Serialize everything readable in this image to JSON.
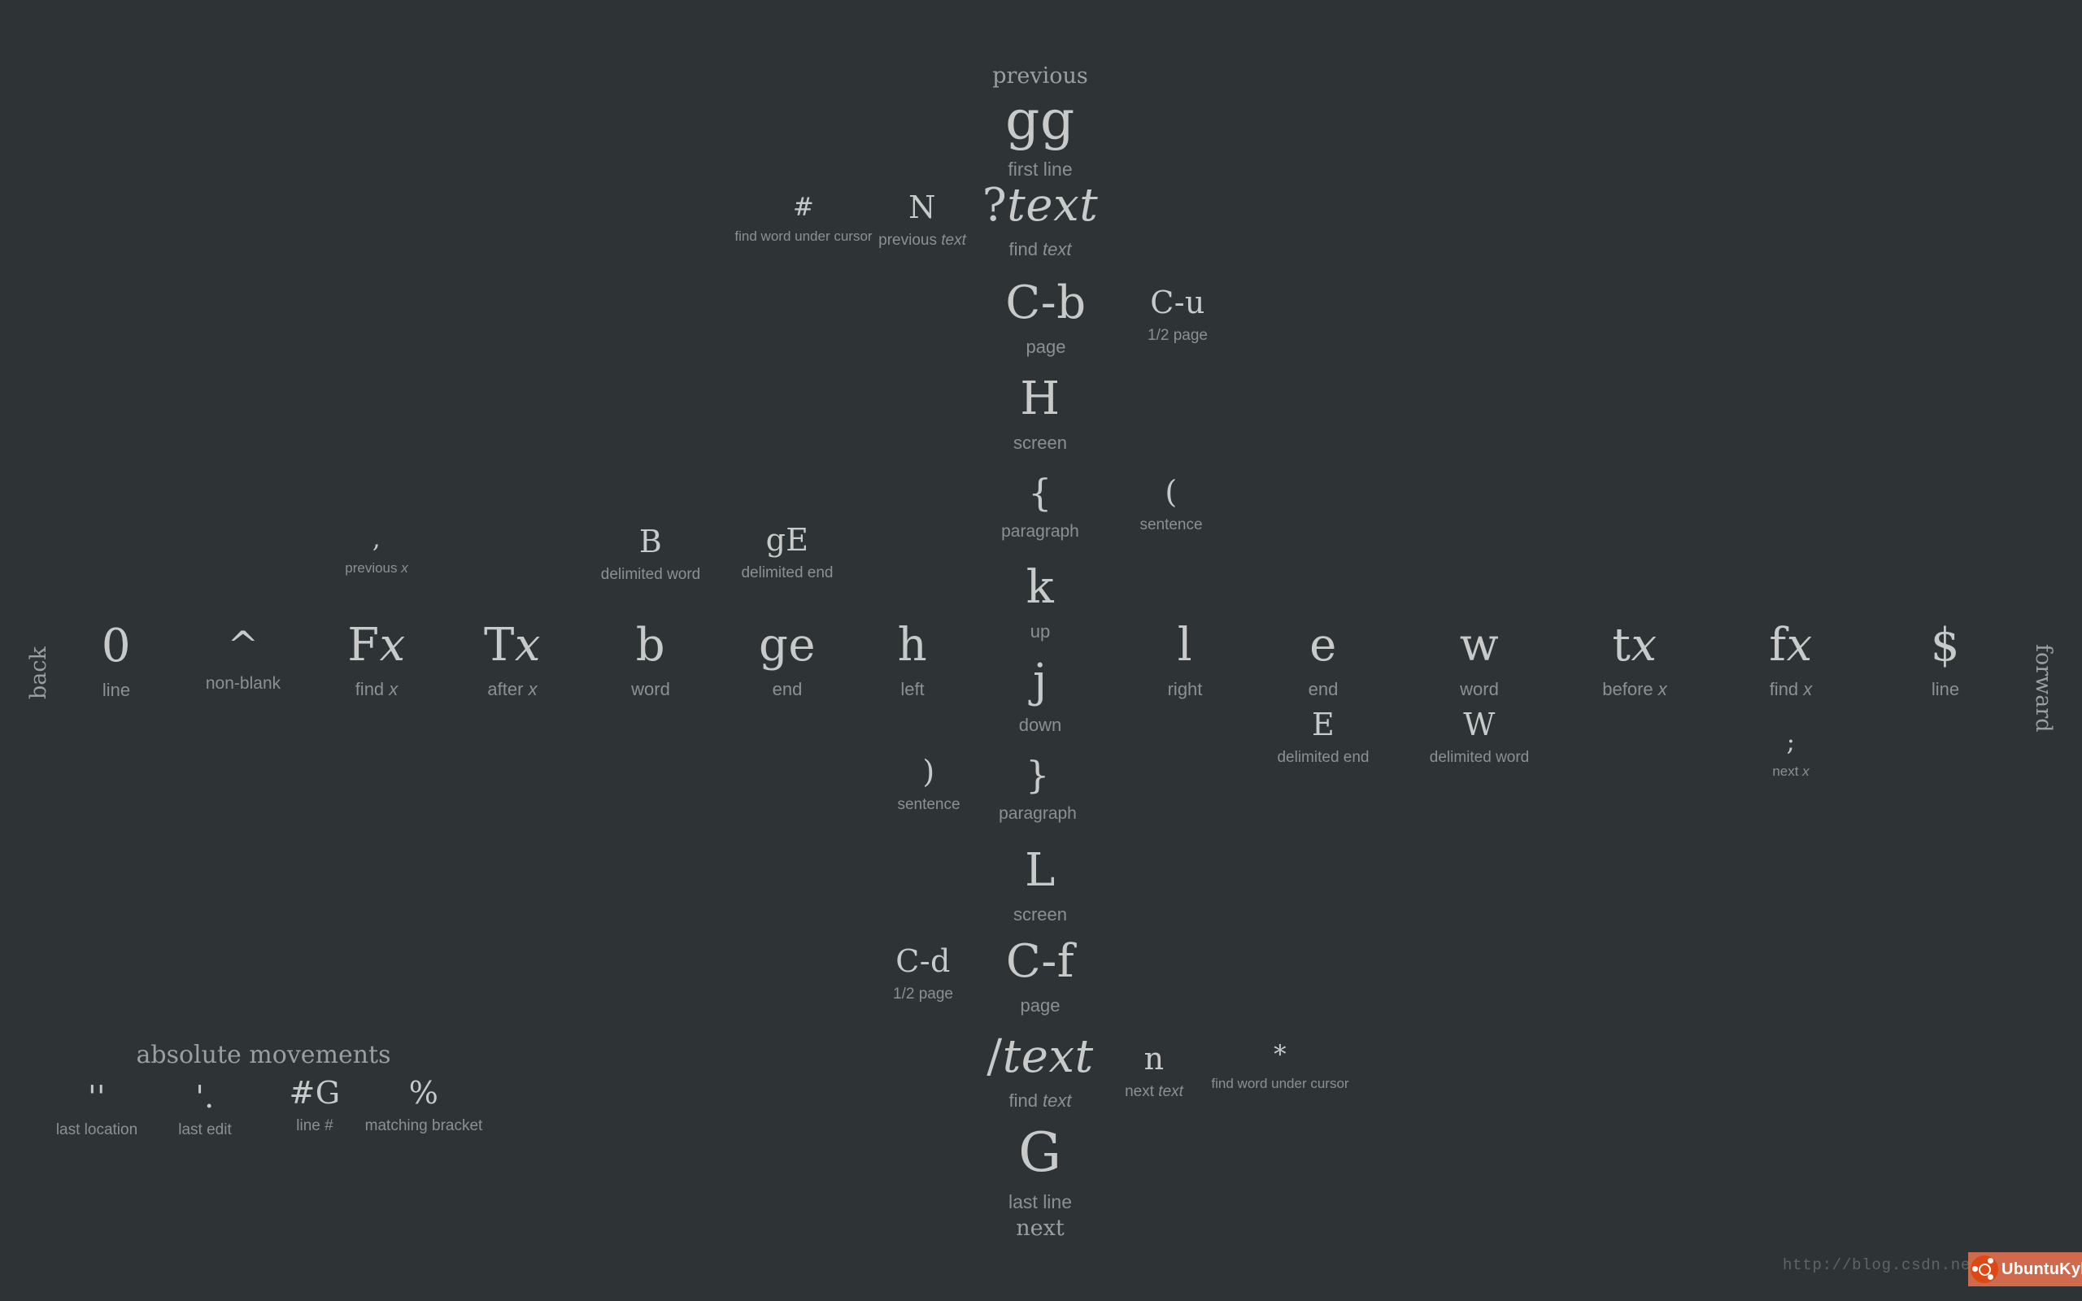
{
  "background_color": "#2e3436",
  "key_color": "#c7cac9",
  "desc_color": "#8b9193",
  "axes": {
    "top": "previous",
    "bottom": "next",
    "left": "back",
    "right": "forward"
  },
  "groups": {
    "absolute_movements": "absolute movements"
  },
  "cells": {
    "gg": {
      "key": "gg",
      "desc": "first line"
    },
    "hash": {
      "key": "#",
      "desc": "find word under cursor"
    },
    "N": {
      "key": "N",
      "desc_pre": "previous ",
      "desc_it": "text"
    },
    "qtext": {
      "key_pre": "?",
      "key_it": "text",
      "desc_pre": "find ",
      "desc_it": "text"
    },
    "Cb": {
      "key": "C-b",
      "desc": "page"
    },
    "Cu": {
      "key": "C-u",
      "desc": "1/2 page"
    },
    "H": {
      "key": "H",
      "desc": "screen"
    },
    "brace_open": {
      "key": "{",
      "desc": "paragraph"
    },
    "paren_open": {
      "key": "(",
      "desc": "sentence"
    },
    "k": {
      "key": "k",
      "desc": "up"
    },
    "comma": {
      "key": ",",
      "desc_pre": "previous ",
      "desc_it": "x"
    },
    "B": {
      "key": "B",
      "desc": "delimited word"
    },
    "gE": {
      "key": "gE",
      "desc": "delimited end"
    },
    "zero": {
      "key": "0",
      "desc": "line"
    },
    "caret": {
      "key": "^",
      "desc": "non-blank"
    },
    "Fx": {
      "key_pre": "F",
      "key_it": "x",
      "desc_pre": "find ",
      "desc_it": "x"
    },
    "Tx": {
      "key_pre": "T",
      "key_it": "x",
      "desc_pre": "after ",
      "desc_it": "x"
    },
    "b": {
      "key": "b",
      "desc": "word"
    },
    "ge": {
      "key": "ge",
      "desc": "end"
    },
    "h": {
      "key": "h",
      "desc": "left"
    },
    "j": {
      "key": "j",
      "desc": "down"
    },
    "l": {
      "key": "l",
      "desc": "right"
    },
    "e": {
      "key": "e",
      "desc": "end"
    },
    "w": {
      "key": "w",
      "desc": "word"
    },
    "tx": {
      "key_pre": "t",
      "key_it": "x",
      "desc_pre": "before ",
      "desc_it": "x"
    },
    "fx": {
      "key_pre": "f",
      "key_it": "x",
      "desc_pre": "find ",
      "desc_it": "x"
    },
    "dollar": {
      "key": "$",
      "desc": "line"
    },
    "E": {
      "key": "E",
      "desc": "delimited end"
    },
    "W": {
      "key": "W",
      "desc": "delimited word"
    },
    "semicolon": {
      "key": ";",
      "desc_pre": "next ",
      "desc_it": "x"
    },
    "paren_close": {
      "key": ")",
      "desc": "sentence"
    },
    "brace_close": {
      "key": "}",
      "desc": "paragraph"
    },
    "L": {
      "key": "L",
      "desc": "screen"
    },
    "Cd": {
      "key": "C-d",
      "desc": "1/2 page"
    },
    "Cf": {
      "key": "C-f",
      "desc": "page"
    },
    "slashtext": {
      "key_pre": "/",
      "key_it": "text",
      "desc_pre": "find ",
      "desc_it": "text"
    },
    "n": {
      "key": "n",
      "desc_pre": "next ",
      "desc_it": "text"
    },
    "star": {
      "key": "*",
      "desc": "find word under cursor"
    },
    "G": {
      "key": "G",
      "desc": "last line"
    },
    "tick_tick": {
      "key": "''",
      "desc": "last location"
    },
    "tick_dot": {
      "key": "'.",
      "desc": "last edit"
    },
    "hashG": {
      "key": "#G",
      "desc": "line #"
    },
    "percent": {
      "key": "%",
      "desc": "matching bracket"
    }
  },
  "watermark": {
    "url": "http://blog.csdn.net/git",
    "badge_label": "UbuntuKylin",
    "badge_color": "#cf6a4c",
    "logo_color": "#dd4814"
  }
}
